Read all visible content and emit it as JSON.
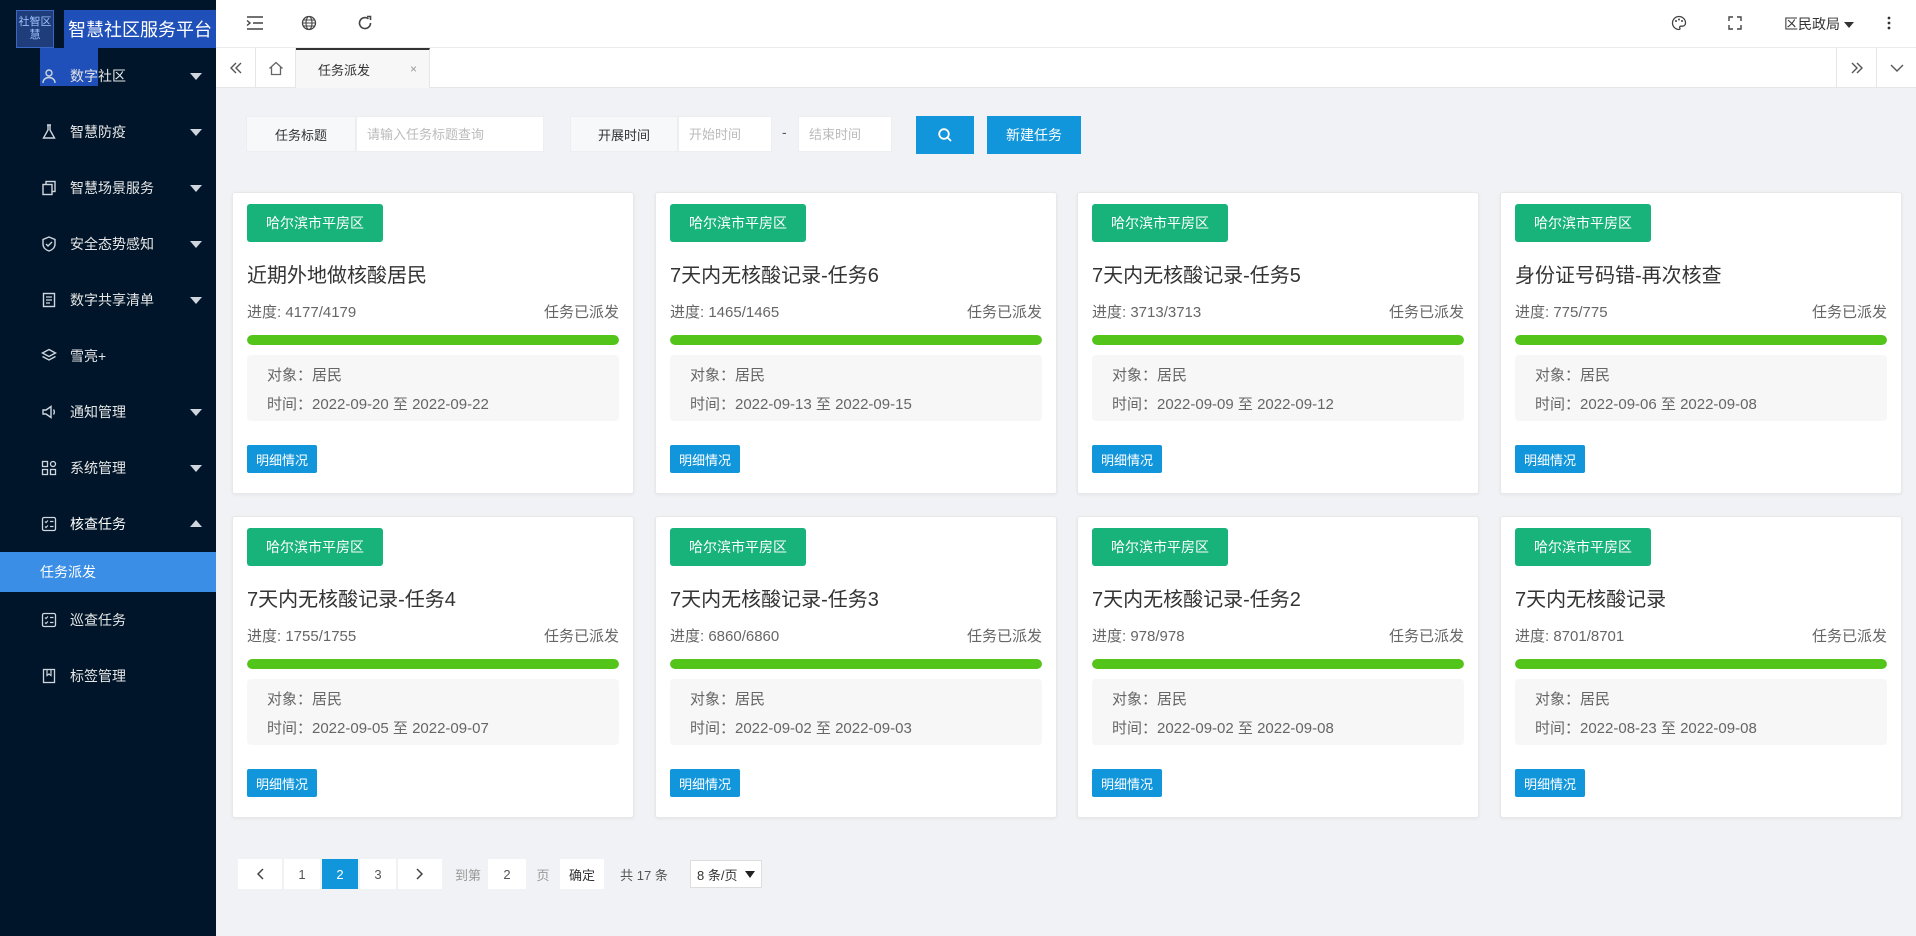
{
  "app": {
    "title": "智慧社区服务平台",
    "logo_text": [
      "社",
      "智",
      "区",
      "慧"
    ]
  },
  "sidebar": {
    "items": [
      {
        "label": "数字社区",
        "icon": "user-icon",
        "expanded": false
      },
      {
        "label": "智慧防疫",
        "icon": "flask-icon",
        "expanded": false
      },
      {
        "label": "智慧场景服务",
        "icon": "copy-icon",
        "expanded": false
      },
      {
        "label": "安全态势感知",
        "icon": "shield-icon",
        "expanded": false
      },
      {
        "label": "数字共享清单",
        "icon": "list-icon",
        "expanded": false
      },
      {
        "label": "雪亮+",
        "icon": "layers-icon",
        "expanded": null
      },
      {
        "label": "通知管理",
        "icon": "speaker-icon",
        "expanded": false
      },
      {
        "label": "系统管理",
        "icon": "grid-icon",
        "expanded": false
      },
      {
        "label": "核查任务",
        "icon": "checklist-icon",
        "expanded": true
      }
    ],
    "active_sub": "任务派发",
    "after": [
      {
        "label": "巡查任务",
        "icon": "checklist-icon"
      },
      {
        "label": "标签管理",
        "icon": "bookmark-icon"
      }
    ]
  },
  "header": {
    "user": "区民政局"
  },
  "tabs": {
    "active": "任务派发",
    "close": "×"
  },
  "search": {
    "title_label": "任务标题",
    "title_placeholder": "请输入任务标题查询",
    "time_label": "开展时间",
    "start_placeholder": "开始时间",
    "dash": "-",
    "end_placeholder": "结束时间",
    "new_task": "新建任务"
  },
  "cards": [
    {
      "tag": "哈尔滨市平房区",
      "title": "近期外地做核酸居民",
      "progress": "进度: 4177/4179",
      "fraction": 0.9995,
      "status": "任务已派发",
      "target": "对象：居民",
      "time": "时间：2022-09-20 至 2022-09-22",
      "btn": "明细情况"
    },
    {
      "tag": "哈尔滨市平房区",
      "title": "7天内无核酸记录-任务6",
      "progress": "进度: 1465/1465",
      "fraction": 1,
      "status": "任务已派发",
      "target": "对象：居民",
      "time": "时间：2022-09-13 至 2022-09-15",
      "btn": "明细情况"
    },
    {
      "tag": "哈尔滨市平房区",
      "title": "7天内无核酸记录-任务5",
      "progress": "进度: 3713/3713",
      "fraction": 1,
      "status": "任务已派发",
      "target": "对象：居民",
      "time": "时间：2022-09-09 至 2022-09-12",
      "btn": "明细情况"
    },
    {
      "tag": "哈尔滨市平房区",
      "title": "身份证号码错-再次核查",
      "progress": "进度: 775/775",
      "fraction": 1,
      "status": "任务已派发",
      "target": "对象：居民",
      "time": "时间：2022-09-06 至 2022-09-08",
      "btn": "明细情况"
    },
    {
      "tag": "哈尔滨市平房区",
      "title": "7天内无核酸记录-任务4",
      "progress": "进度: 1755/1755",
      "fraction": 1,
      "status": "任务已派发",
      "target": "对象：居民",
      "time": "时间：2022-09-05 至 2022-09-07",
      "btn": "明细情况"
    },
    {
      "tag": "哈尔滨市平房区",
      "title": "7天内无核酸记录-任务3",
      "progress": "进度: 6860/6860",
      "fraction": 1,
      "status": "任务已派发",
      "target": "对象：居民",
      "time": "时间：2022-09-02 至 2022-09-03",
      "btn": "明细情况"
    },
    {
      "tag": "哈尔滨市平房区",
      "title": "7天内无核酸记录-任务2",
      "progress": "进度: 978/978",
      "fraction": 1,
      "status": "任务已派发",
      "target": "对象：居民",
      "time": "时间：2022-09-02 至 2022-09-08",
      "btn": "明细情况"
    },
    {
      "tag": "哈尔滨市平房区",
      "title": "7天内无核酸记录",
      "progress": "进度: 8701/8701",
      "fraction": 1,
      "status": "任务已派发",
      "target": "对象：居民",
      "time": "时间：2022-08-23 至 2022-09-08",
      "btn": "明细情况"
    }
  ],
  "pagination": {
    "pages": [
      "1",
      "2",
      "3"
    ],
    "current": "2",
    "goto_label": "到第",
    "goto_value": "2",
    "page_unit": "页",
    "confirm": "确定",
    "total": "共 17 条",
    "page_size": "8 条/页"
  },
  "colors": {
    "sidebar": "#001529",
    "accent": "#1296db",
    "tag": "#17b37a",
    "progress": "#52c41a"
  }
}
